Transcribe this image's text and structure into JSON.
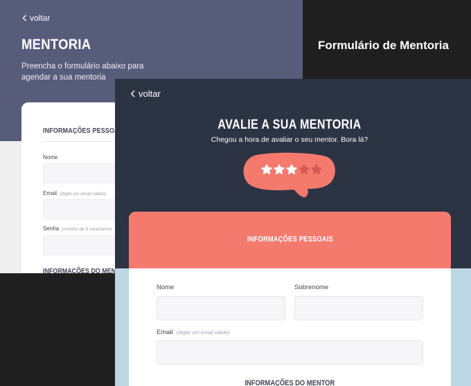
{
  "back_screen": {
    "back_link": "voltar",
    "title": "MENTORIA",
    "subtitle": "Preencha o formulário abaixo para agendar a sua mentoria",
    "form": {
      "section_personal": "INFORMAÇÕES PESSOAIS",
      "name_label": "Nome",
      "email_label": "Email",
      "email_hint": "(digite um email válido)",
      "password_label": "Senha",
      "password_hint": "(mínimo de 6 caracteres)",
      "section_mentor": "INFORMAÇÕES DO MENTOR"
    }
  },
  "caption": "Formulário de Mentoria",
  "front_screen": {
    "back_link": "voltar",
    "title": "AVALIE A SUA MENTORIA",
    "subtitle": "Chegou a hora de avaliar o seu mentor. Bora lá?",
    "rating": {
      "value": 3,
      "max": 5
    },
    "form": {
      "section_personal": "INFORMAÇÕES PESSOAIS",
      "name_label": "Nome",
      "surname_label": "Sobrenome",
      "email_label": "Email",
      "email_hint": "(digite um email válido)",
      "section_mentor": "INFORMAÇÕES DO MENTOR"
    }
  },
  "colors": {
    "back_header": "#585c7b",
    "front_header": "#2c3444",
    "accent_coral": "#f47a6e",
    "front_bottom": "#bcd6e4",
    "star_filled": "#ffffff",
    "star_empty": "#d25a52"
  },
  "icons": {
    "back": "chevron-left-icon",
    "star": "star-icon"
  }
}
